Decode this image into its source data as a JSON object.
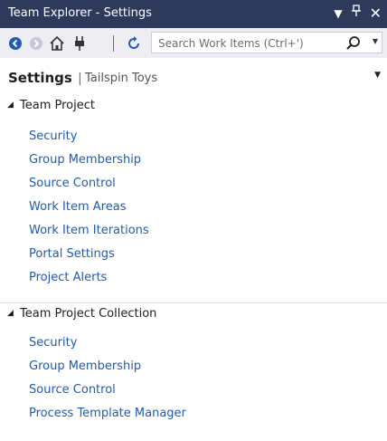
{
  "window": {
    "title": "Team Explorer - Settings",
    "controls": {
      "dropdown": "▼",
      "pin": "ᚆ",
      "close": "✕"
    }
  },
  "toolbar": {
    "search_placeholder": "Search Work Items (Ctrl+')",
    "icons": [
      "back-icon",
      "forward-icon",
      "home-icon",
      "connect-icon",
      "refresh-icon",
      "search-icon"
    ]
  },
  "header": {
    "title": "Settings",
    "separator": "|",
    "subtitle": "Tailspin Toys"
  },
  "sections": [
    {
      "label": "Team Project",
      "items": [
        "Security",
        "Group Membership",
        "Source Control",
        "Work Item Areas",
        "Work Item Iterations",
        "Portal Settings",
        "Project Alerts"
      ]
    },
    {
      "label": "Team Project Collection",
      "items": [
        "Security",
        "Group Membership",
        "Source Control",
        "Process Template Manager"
      ]
    }
  ],
  "colors": {
    "titlebar": "#2d3a5c",
    "link": "#1e5bb8",
    "toolbar": "#eeeef2"
  }
}
